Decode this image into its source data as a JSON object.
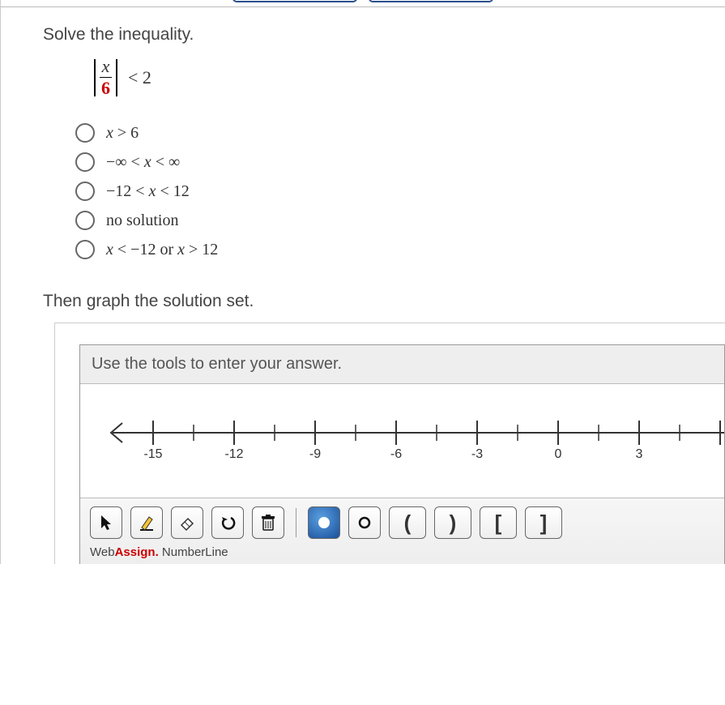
{
  "question": {
    "prompt": "Solve the inequality.",
    "inequality": {
      "numerator": "x",
      "denominator": "6",
      "rhs": "< 2"
    },
    "options": [
      {
        "html": "x > 6"
      },
      {
        "html": "−∞ < x < ∞"
      },
      {
        "html": "−12 < x < 12"
      },
      {
        "html": "no solution"
      },
      {
        "html": "x < −12 or x > 12"
      }
    ],
    "graph_prompt": "Then graph the solution set."
  },
  "numberline": {
    "header": "Use the tools to enter your answer.",
    "ticks": [
      "-15",
      "-12",
      "-9",
      "-6",
      "-3",
      "0",
      "3"
    ],
    "brand": {
      "part1": "Web",
      "part2": "Assign.",
      "part3": " NumberLine"
    }
  },
  "toolbar": {
    "tools": [
      {
        "name": "select-arrow-icon"
      },
      {
        "name": "draw-pencil-icon"
      },
      {
        "name": "eraser-icon"
      },
      {
        "name": "undo-icon"
      },
      {
        "name": "trash-icon"
      }
    ],
    "points": [
      {
        "name": "closed-point-icon",
        "active": true
      },
      {
        "name": "open-point-icon",
        "active": false
      }
    ],
    "brackets": [
      {
        "name": "open-paren-left-icon",
        "glyph": "("
      },
      {
        "name": "open-paren-right-icon",
        "glyph": ")"
      },
      {
        "name": "closed-bracket-left-icon",
        "glyph": "["
      },
      {
        "name": "closed-bracket-right-icon",
        "glyph": "]"
      }
    ]
  }
}
